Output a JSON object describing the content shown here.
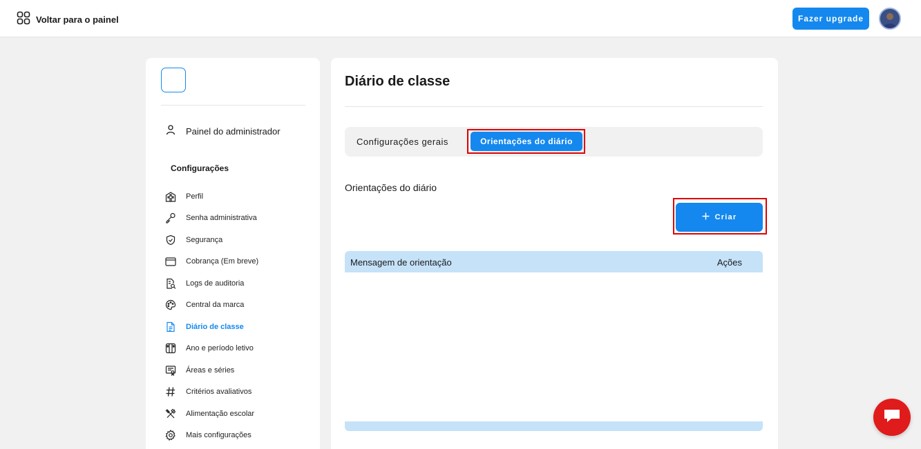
{
  "topbar": {
    "back_label": "Voltar para o painel",
    "upgrade_label": "Fazer upgrade"
  },
  "sidebar": {
    "admin_label": "Painel do administrador",
    "section_label": "Configurações",
    "items": [
      {
        "label": "Perfil",
        "icon": "building-icon"
      },
      {
        "label": "Senha administrativa",
        "icon": "key-icon"
      },
      {
        "label": "Segurança",
        "icon": "shield-icon"
      },
      {
        "label": "Cobrança (Em breve)",
        "icon": "wallet-icon"
      },
      {
        "label": "Logs de auditoria",
        "icon": "document-search-icon"
      },
      {
        "label": "Central da marca",
        "icon": "palette-icon"
      },
      {
        "label": "Diário de classe",
        "icon": "document-icon"
      },
      {
        "label": "Ano e período letivo",
        "icon": "calendar-columns-icon"
      },
      {
        "label": "Áreas e séries",
        "icon": "certificate-icon"
      },
      {
        "label": "Critérios avaliativos",
        "icon": "hash-icon"
      },
      {
        "label": "Alimentação escolar",
        "icon": "utensils-icon"
      },
      {
        "label": "Mais configurações",
        "icon": "gear-icon"
      }
    ],
    "active_item": "Diário de classe"
  },
  "main": {
    "title": "Diário de classe",
    "tabs": [
      {
        "label": "Configurações gerais",
        "active": false
      },
      {
        "label": "Orientações do diário",
        "active": true
      }
    ],
    "section_title": "Orientações do diário",
    "create_label": "Criar",
    "table": {
      "columns": [
        "Mensagem de orientação",
        "Ações"
      ],
      "rows": []
    }
  },
  "colors": {
    "accent": "#1488ee",
    "highlight_frame": "#e00000",
    "table_header": "#c5e2f9",
    "chat": "#e01b1b"
  }
}
